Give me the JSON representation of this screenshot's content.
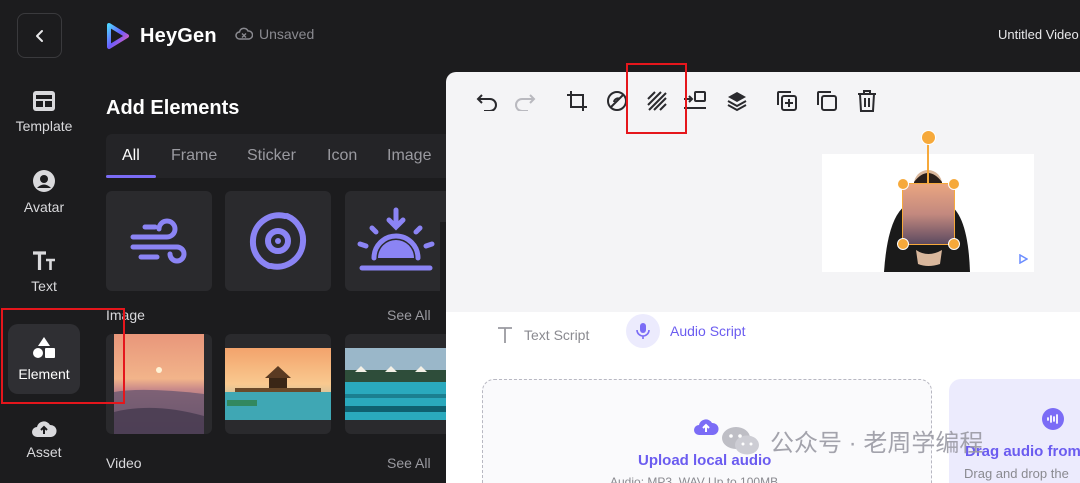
{
  "topbar": {
    "brand": "HeyGen",
    "status": "Unsaved",
    "project_title": "Untitled Video"
  },
  "rail": {
    "items": [
      {
        "label": "Template",
        "icon": "template-icon"
      },
      {
        "label": "Avatar",
        "icon": "avatar-icon"
      },
      {
        "label": "Text",
        "icon": "text-icon"
      },
      {
        "label": "Element",
        "icon": "shapes-icon",
        "active": true
      },
      {
        "label": "Asset",
        "icon": "cloud-upload-icon"
      }
    ]
  },
  "panel": {
    "title": "Add Elements",
    "tabs": [
      "All",
      "Frame",
      "Sticker",
      "Icon",
      "Image"
    ],
    "active_tab": "All",
    "icon_tiles": [
      "wind-icon",
      "hurricane-icon",
      "sunset-icon"
    ],
    "sections": {
      "image_label": "Image",
      "image_see_all": "See All",
      "video_label": "Video",
      "video_see_all": "See All"
    }
  },
  "toolbar": {
    "icons": [
      "undo-icon",
      "redo-icon",
      "crop-icon",
      "no-background-icon",
      "pattern-icon",
      "align-icon",
      "layers-icon",
      "add-copy-icon",
      "duplicate-icon",
      "delete-icon"
    ]
  },
  "script": {
    "text_tab": "Text Script",
    "audio_tab": "Audio Script",
    "active_tab": "Audio Script",
    "upload_title": "Upload local audio",
    "upload_subtitle": "Audio: MP3, WAV Up to 100MB",
    "drag_title": "Drag audio from",
    "drag_subtitle": "Drag and drop the"
  },
  "watermark": "公众号 · 老周学编程",
  "colors": {
    "accent": "#7b6cf6",
    "highlight": "#e5161c",
    "handle": "#f6a93b"
  }
}
